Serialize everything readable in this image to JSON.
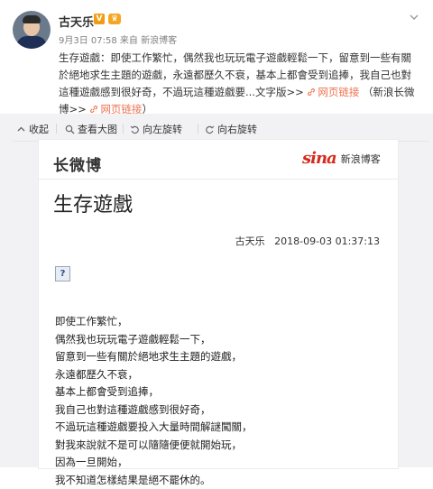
{
  "post": {
    "author": "古天乐",
    "verified_badge": "V",
    "level_badge": "♛",
    "meta": "9月3日 07:58 来自 新浪博客",
    "text_intro": "生存遊戲：即使工作繁忙，偶然我也玩玩電子遊戲輕鬆一下，留意到一些有關於絕地求生主題的遊戲，永遠都歷久不衰，基本上都會受到追捧，我自己也對這種遊戲感到很好奇，不過玩這種遊戲要...文字版>>",
    "link1": "网页链接",
    "text_mid": "（新浪长微博>>",
    "link2": "网页链接",
    "text_end": "）"
  },
  "toolbar": {
    "collapse": "收起",
    "view_large": "查看大图",
    "rotate_left": "向左旋转",
    "rotate_right": "向右旋转"
  },
  "card": {
    "brand": "长微博",
    "sina_word": "sina",
    "sina_blog": "新浪博客",
    "title": "生存遊戲",
    "author": "古天乐",
    "datetime": "2018-09-03 01:37:13",
    "broken_image": "?",
    "body": [
      "即使工作繁忙，",
      "偶然我也玩玩電子遊戲輕鬆一下，",
      "留意到一些有關於絕地求生主題的遊戲，",
      "永遠都歷久不衰，",
      "基本上都會受到追捧，",
      "我自己也對這種遊戲感到很好奇，",
      "不過玩這種遊戲要投入大量時間解謎闖關，",
      "對我來說就不是可以隨隨便便就開始玩，",
      "因為一旦開始，",
      "我不知道怎樣結果是絕不罷休的。"
    ]
  },
  "colors": {
    "link": "#eb7350",
    "sina_red": "#d52b1e",
    "toolbar_bg": "#f2f2f5"
  }
}
